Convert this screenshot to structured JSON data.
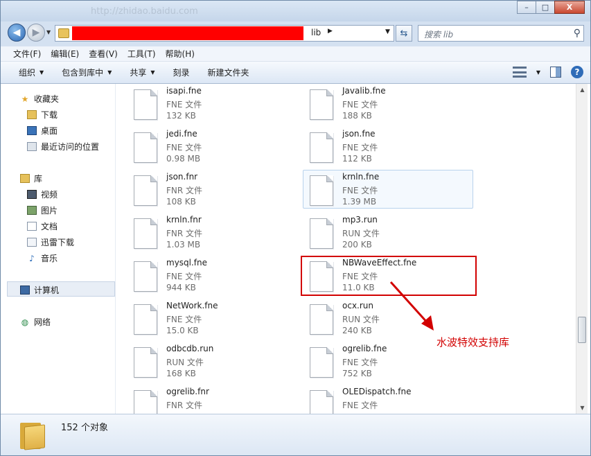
{
  "titlebar": {
    "faded_url": "http://zhidao.baidu.com",
    "minimize": "–",
    "maximize": "□",
    "close": "X"
  },
  "nav": {
    "address_current": "lib",
    "search_placeholder": "搜索 lib"
  },
  "menu": [
    "文件(F)",
    "编辑(E)",
    "查看(V)",
    "工具(T)",
    "帮助(H)"
  ],
  "toolbar": {
    "organize": "组织",
    "include_in_library": "包含到库中",
    "share": "共享",
    "burn": "刻录",
    "new_folder": "新建文件夹"
  },
  "sidebar": {
    "favorites": "收藏夹",
    "downloads": "下载",
    "desktop": "桌面",
    "recent": "最近访问的位置",
    "libraries": "库",
    "videos": "视频",
    "pictures": "图片",
    "documents": "文档",
    "xunlei": "迅雷下载",
    "music": "音乐",
    "computer": "计算机",
    "network": "网络"
  },
  "files": [
    {
      "name": "isapi.fne",
      "type": "FNE 文件",
      "size": "132 KB"
    },
    {
      "name": "Javalib.fne",
      "type": "FNE 文件",
      "size": "188 KB"
    },
    {
      "name": "jedi.fne",
      "type": "FNE 文件",
      "size": "0.98 MB"
    },
    {
      "name": "json.fne",
      "type": "FNE 文件",
      "size": "112 KB"
    },
    {
      "name": "json.fnr",
      "type": "FNR 文件",
      "size": "108 KB"
    },
    {
      "name": "krnln.fne",
      "type": "FNE 文件",
      "size": "1.39 MB"
    },
    {
      "name": "krnln.fnr",
      "type": "FNR 文件",
      "size": "1.03 MB"
    },
    {
      "name": "mp3.run",
      "type": "RUN 文件",
      "size": "200 KB"
    },
    {
      "name": "mysql.fne",
      "type": "FNE 文件",
      "size": "944 KB"
    },
    {
      "name": "NBWaveEffect.fne",
      "type": "FNE 文件",
      "size": "11.0 KB"
    },
    {
      "name": "NetWork.fne",
      "type": "FNE 文件",
      "size": "15.0 KB"
    },
    {
      "name": "ocx.run",
      "type": "RUN 文件",
      "size": "240 KB"
    },
    {
      "name": "odbcdb.run",
      "type": "RUN 文件",
      "size": "168 KB"
    },
    {
      "name": "ogrelib.fne",
      "type": "FNE 文件",
      "size": "752 KB"
    },
    {
      "name": "ogrelib.fnr",
      "type": "FNR 文件",
      "size": ""
    },
    {
      "name": "OLEDispatch.fne",
      "type": "FNE 文件",
      "size": ""
    }
  ],
  "annotation": "水波特效支持库",
  "status": {
    "item_count": "152 个对象"
  },
  "colors": {
    "highlight": "#d20000",
    "chrome": "#d4e1f1"
  }
}
